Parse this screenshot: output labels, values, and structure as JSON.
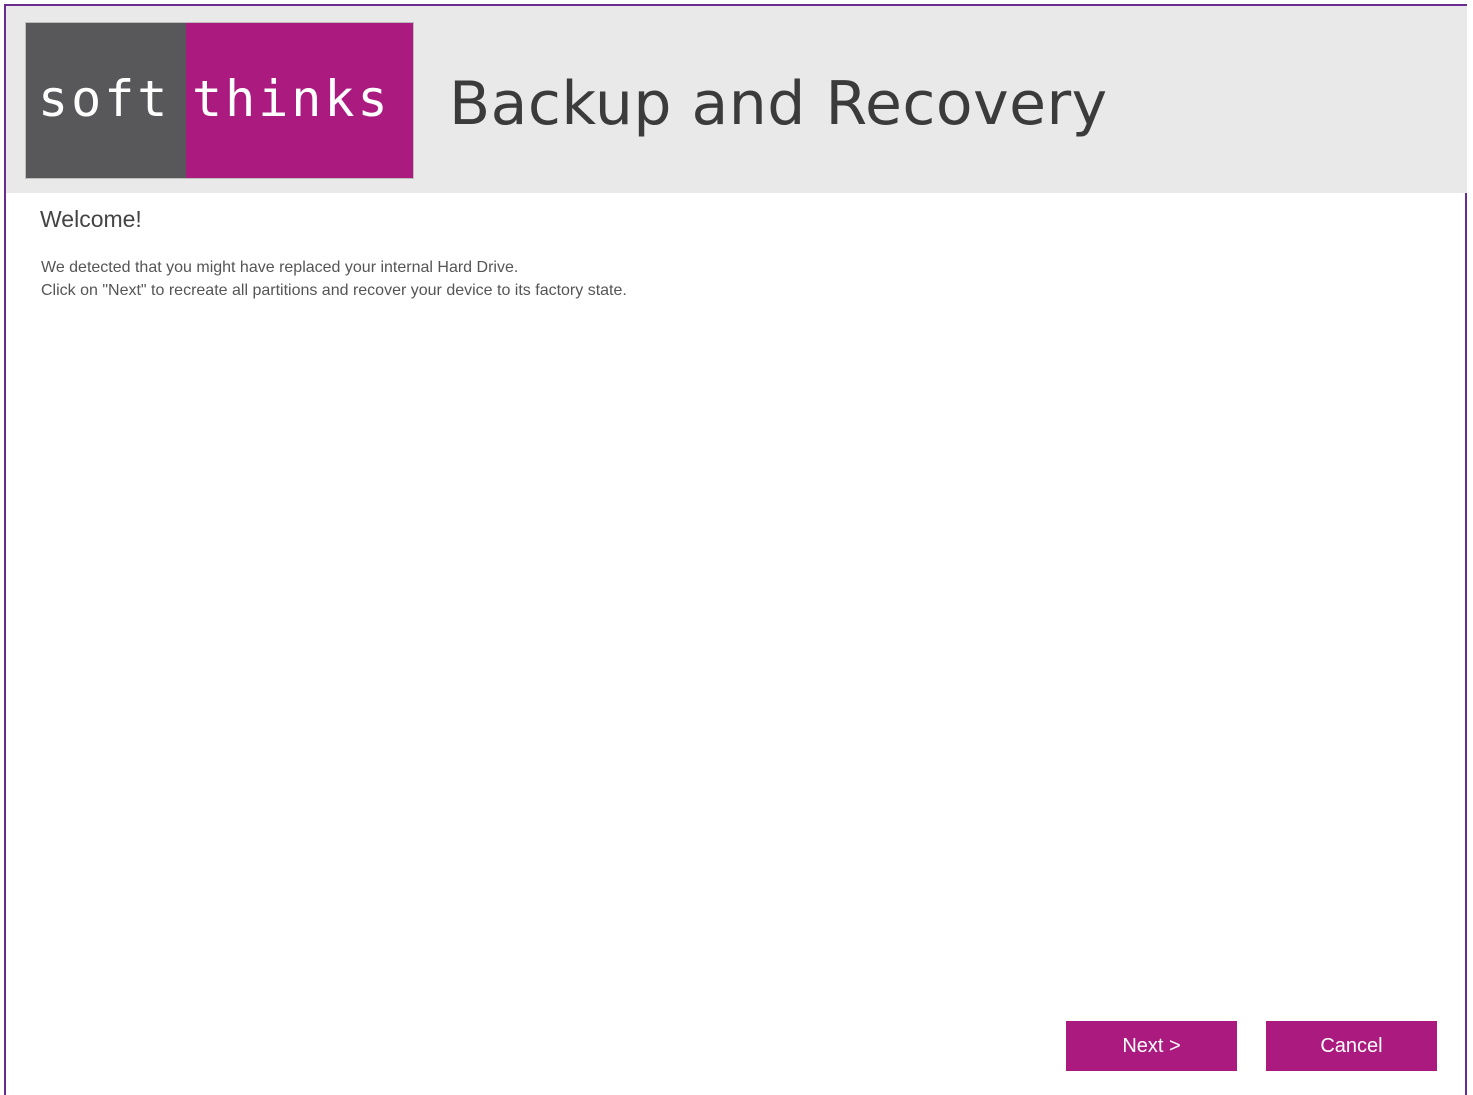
{
  "logo": {
    "part_one": "soft",
    "part_two": "thinks"
  },
  "header": {
    "title": "Backup and Recovery"
  },
  "main": {
    "heading": "Welcome!",
    "lines": [
      "We detected that you might have replaced your internal Hard Drive.",
      "Click on \"Next\" to recreate all partitions and recover your device to its factory state."
    ]
  },
  "footer": {
    "next_label": "Next >",
    "cancel_label": "Cancel"
  },
  "colors": {
    "accent": "#ab1b7f",
    "logo_gray": "#58585a",
    "header_bg": "#e9e9e9",
    "window_border": "#6a2c91"
  }
}
